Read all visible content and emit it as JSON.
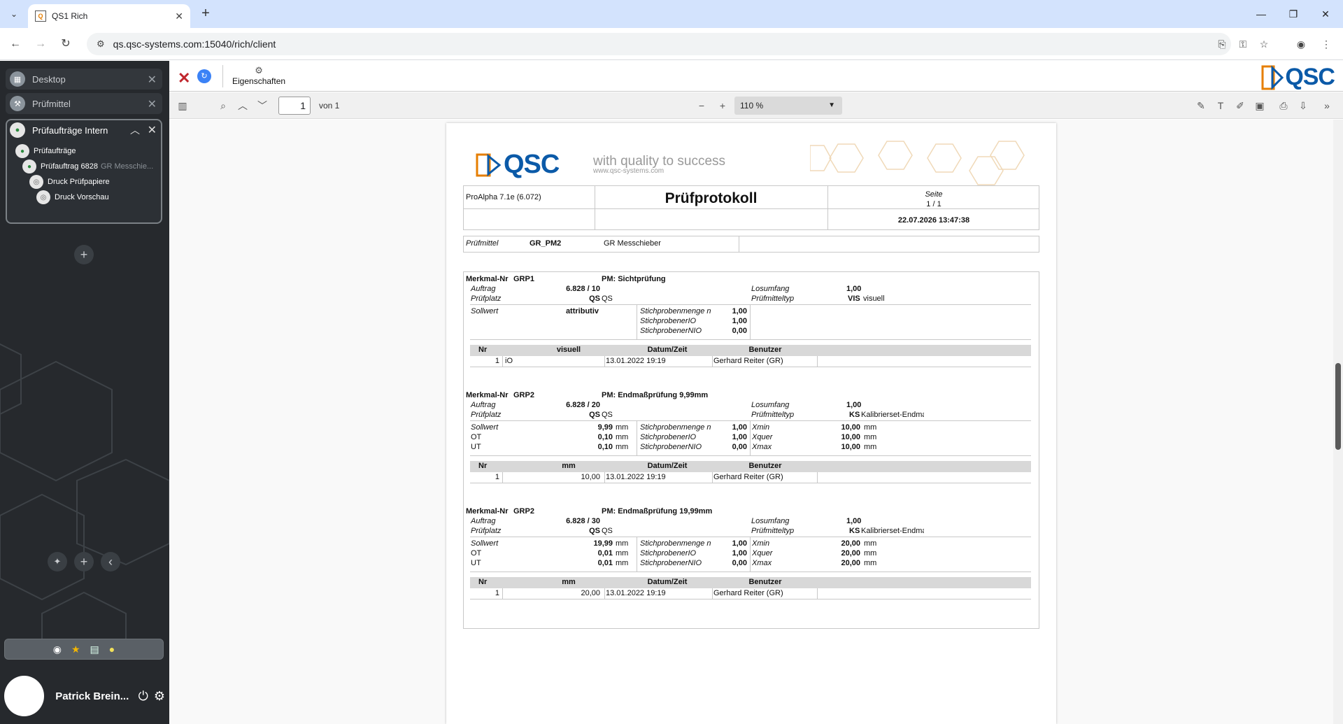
{
  "browser": {
    "tab_title": "QS1 Rich",
    "url": "qs.qsc-systems.com:15040/rich/client"
  },
  "sidebar": {
    "items": [
      {
        "label": "Desktop"
      },
      {
        "label": "Prüfmittel"
      }
    ],
    "group": {
      "label": "Prüfaufträge Intern",
      "children": [
        {
          "label": "Prüfaufträge",
          "muted": ""
        },
        {
          "label": "Prüfauftrag 6828",
          "muted": "GR Messchie..."
        },
        {
          "label": "Druck Prüfpapiere",
          "muted": ""
        },
        {
          "label": "Druck Vorschau",
          "muted": ""
        }
      ]
    },
    "user": "Patrick Brein..."
  },
  "toolbar": {
    "props_label": "Eigenschaften",
    "logo": "QSC"
  },
  "pdf": {
    "page": "1",
    "page_of": "von 1",
    "zoom": "110 %"
  },
  "doc": {
    "logo": "QSC",
    "slogan": "with quality to success",
    "website": "www.qsc-systems.com",
    "header": {
      "software": "ProAlpha 7.1e (6.072)",
      "title": "Prüfprotokoll",
      "seite_label": "Seite",
      "seite_value": "1 / 1",
      "datetime": "22.07.2026  13:47:38"
    },
    "pruefmittel": {
      "label": "Prüfmittel",
      "code": "GR_PM2",
      "name": "GR Messchieber"
    },
    "features": [
      {
        "merkmal_label": "Merkmal-Nr",
        "merkmal": "GRP1",
        "pm": "PM: Sichtprüfung",
        "auftrag_label": "Auftrag",
        "auftrag": "6.828 / 10",
        "platz_label": "Prüfplatz",
        "platz_code": "QS",
        "platz_name": "QS",
        "los_label": "Losumfang",
        "los": "1,00",
        "typ_label": "Prüfmitteltyp",
        "typ_code": "VIS",
        "typ_name": "visuell",
        "rows": [
          {
            "l": "Sollwert",
            "v": "attributiv",
            "u": ""
          }
        ],
        "stich": [
          {
            "l": "Stichprobenmenge n",
            "v": "1,00"
          },
          {
            "l": "StichprobenerIO",
            "v": "1,00"
          },
          {
            "l": "StichprobenerNIO",
            "v": "0,00"
          }
        ],
        "x": [],
        "table_head": [
          "Nr",
          "visuell",
          "Datum/Zeit",
          "Benutzer"
        ],
        "table_row": [
          "1",
          "iO",
          "13.01.2022 19:19",
          "Gerhard Reiter (GR)"
        ]
      },
      {
        "merkmal_label": "Merkmal-Nr",
        "merkmal": "GRP2",
        "pm": "PM: Endmaßprüfung 9,99mm",
        "auftrag_label": "Auftrag",
        "auftrag": "6.828 / 20",
        "platz_label": "Prüfplatz",
        "platz_code": "QS",
        "platz_name": "QS",
        "los_label": "Losumfang",
        "los": "1,00",
        "typ_label": "Prüfmitteltyp",
        "typ_code": "KS",
        "typ_name": "Kalibrierset-Endmaße",
        "rows": [
          {
            "l": "Sollwert",
            "v": "9,99",
            "u": "mm"
          },
          {
            "l": "OT",
            "v": "0,10",
            "u": "mm"
          },
          {
            "l": "UT",
            "v": "0,10",
            "u": "mm"
          }
        ],
        "stich": [
          {
            "l": "Stichprobenmenge n",
            "v": "1,00"
          },
          {
            "l": "StichprobenerIO",
            "v": "1,00"
          },
          {
            "l": "StichprobenerNIO",
            "v": "0,00"
          }
        ],
        "x": [
          {
            "l": "Xmin",
            "v": "10,00",
            "u": "mm"
          },
          {
            "l": "Xquer",
            "v": "10,00",
            "u": "mm"
          },
          {
            "l": "Xmax",
            "v": "10,00",
            "u": "mm"
          }
        ],
        "table_head": [
          "Nr",
          "mm",
          "Datum/Zeit",
          "Benutzer"
        ],
        "table_row": [
          "1",
          "10,00",
          "13.01.2022 19:19",
          "Gerhard Reiter (GR)"
        ]
      },
      {
        "merkmal_label": "Merkmal-Nr",
        "merkmal": "GRP2",
        "pm": "PM: Endmaßprüfung 19,99mm",
        "auftrag_label": "Auftrag",
        "auftrag": "6.828 / 30",
        "platz_label": "Prüfplatz",
        "platz_code": "QS",
        "platz_name": "QS",
        "los_label": "Losumfang",
        "los": "1,00",
        "typ_label": "Prüfmitteltyp",
        "typ_code": "KS",
        "typ_name": "Kalibrierset-Endmaße",
        "rows": [
          {
            "l": "Sollwert",
            "v": "19,99",
            "u": "mm"
          },
          {
            "l": "OT",
            "v": "0,01",
            "u": "mm"
          },
          {
            "l": "UT",
            "v": "0,01",
            "u": "mm"
          }
        ],
        "stich": [
          {
            "l": "Stichprobenmenge n",
            "v": "1,00"
          },
          {
            "l": "StichprobenerIO",
            "v": "1,00"
          },
          {
            "l": "StichprobenerNIO",
            "v": "0,00"
          }
        ],
        "x": [
          {
            "l": "Xmin",
            "v": "20,00",
            "u": "mm"
          },
          {
            "l": "Xquer",
            "v": "20,00",
            "u": "mm"
          },
          {
            "l": "Xmax",
            "v": "20,00",
            "u": "mm"
          }
        ],
        "table_head": [
          "Nr",
          "mm",
          "Datum/Zeit",
          "Benutzer"
        ],
        "table_row": [
          "1",
          "20,00",
          "13.01.2022 19:19",
          "Gerhard Reiter (GR)"
        ]
      }
    ]
  },
  "colors": {
    "sidebar_bg": "#26292d",
    "qsc_blue": "#0b5aa8",
    "qsc_orange": "#e67e00",
    "close_red": "#c0262d"
  }
}
